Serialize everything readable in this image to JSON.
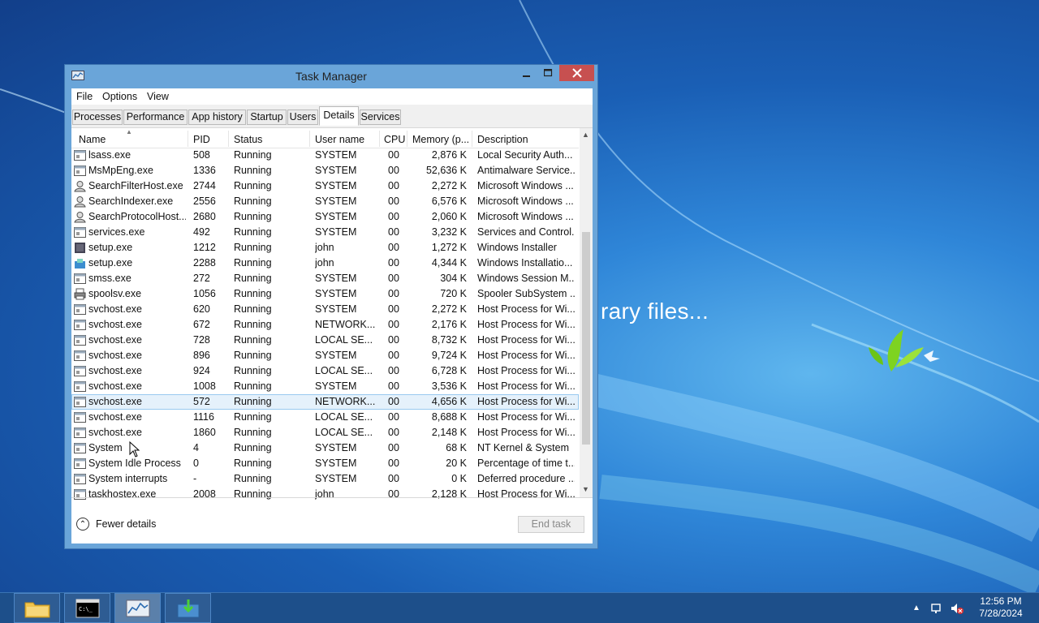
{
  "desktop": {
    "background_text": "rary files..."
  },
  "window": {
    "title": "Task Manager"
  },
  "menu": [
    "File",
    "Options",
    "View"
  ],
  "tabs": [
    {
      "label": "Processes"
    },
    {
      "label": "Performance"
    },
    {
      "label": "App history"
    },
    {
      "label": "Startup"
    },
    {
      "label": "Users"
    },
    {
      "label": "Details",
      "active": true
    },
    {
      "label": "Services"
    }
  ],
  "columns": {
    "name": "Name",
    "pid": "PID",
    "status": "Status",
    "user": "User name",
    "cpu": "CPU",
    "memory": "Memory (p...",
    "description": "Description"
  },
  "rows": [
    {
      "icon": "app",
      "name": "lsass.exe",
      "pid": "508",
      "status": "Running",
      "user": "SYSTEM",
      "cpu": "00",
      "memory": "2,876 K",
      "description": "Local Security Auth..."
    },
    {
      "icon": "app",
      "name": "MsMpEng.exe",
      "pid": "1336",
      "status": "Running",
      "user": "SYSTEM",
      "cpu": "00",
      "memory": "52,636 K",
      "description": "Antimalware Service..."
    },
    {
      "icon": "search",
      "name": "SearchFilterHost.exe",
      "pid": "2744",
      "status": "Running",
      "user": "SYSTEM",
      "cpu": "00",
      "memory": "2,272 K",
      "description": "Microsoft Windows ..."
    },
    {
      "icon": "search",
      "name": "SearchIndexer.exe",
      "pid": "2556",
      "status": "Running",
      "user": "SYSTEM",
      "cpu": "00",
      "memory": "6,576 K",
      "description": "Microsoft Windows ..."
    },
    {
      "icon": "search",
      "name": "SearchProtocolHost....",
      "pid": "2680",
      "status": "Running",
      "user": "SYSTEM",
      "cpu": "00",
      "memory": "2,060 K",
      "description": "Microsoft Windows ..."
    },
    {
      "icon": "app",
      "name": "services.exe",
      "pid": "492",
      "status": "Running",
      "user": "SYSTEM",
      "cpu": "00",
      "memory": "3,232 K",
      "description": "Services and Control..."
    },
    {
      "icon": "installer",
      "name": "setup.exe",
      "pid": "1212",
      "status": "Running",
      "user": "john",
      "cpu": "00",
      "memory": "1,272 K",
      "description": "Windows Installer"
    },
    {
      "icon": "setup",
      "name": "setup.exe",
      "pid": "2288",
      "status": "Running",
      "user": "john",
      "cpu": "00",
      "memory": "4,344 K",
      "description": "Windows Installatio..."
    },
    {
      "icon": "app",
      "name": "smss.exe",
      "pid": "272",
      "status": "Running",
      "user": "SYSTEM",
      "cpu": "00",
      "memory": "304 K",
      "description": "Windows Session M..."
    },
    {
      "icon": "printer",
      "name": "spoolsv.exe",
      "pid": "1056",
      "status": "Running",
      "user": "SYSTEM",
      "cpu": "00",
      "memory": "720 K",
      "description": "Spooler SubSystem ..."
    },
    {
      "icon": "app",
      "name": "svchost.exe",
      "pid": "620",
      "status": "Running",
      "user": "SYSTEM",
      "cpu": "00",
      "memory": "2,272 K",
      "description": "Host Process for Wi..."
    },
    {
      "icon": "app",
      "name": "svchost.exe",
      "pid": "672",
      "status": "Running",
      "user": "NETWORK...",
      "cpu": "00",
      "memory": "2,176 K",
      "description": "Host Process for Wi..."
    },
    {
      "icon": "app",
      "name": "svchost.exe",
      "pid": "728",
      "status": "Running",
      "user": "LOCAL SE...",
      "cpu": "00",
      "memory": "8,732 K",
      "description": "Host Process for Wi..."
    },
    {
      "icon": "app",
      "name": "svchost.exe",
      "pid": "896",
      "status": "Running",
      "user": "SYSTEM",
      "cpu": "00",
      "memory": "9,724 K",
      "description": "Host Process for Wi..."
    },
    {
      "icon": "app",
      "name": "svchost.exe",
      "pid": "924",
      "status": "Running",
      "user": "LOCAL SE...",
      "cpu": "00",
      "memory": "6,728 K",
      "description": "Host Process for Wi..."
    },
    {
      "icon": "app",
      "name": "svchost.exe",
      "pid": "1008",
      "status": "Running",
      "user": "SYSTEM",
      "cpu": "00",
      "memory": "3,536 K",
      "description": "Host Process for Wi..."
    },
    {
      "icon": "app",
      "name": "svchost.exe",
      "pid": "572",
      "status": "Running",
      "user": "NETWORK...",
      "cpu": "00",
      "memory": "4,656 K",
      "description": "Host Process for Wi...",
      "selected": true
    },
    {
      "icon": "app",
      "name": "svchost.exe",
      "pid": "1116",
      "status": "Running",
      "user": "LOCAL SE...",
      "cpu": "00",
      "memory": "8,688 K",
      "description": "Host Process for Wi..."
    },
    {
      "icon": "app",
      "name": "svchost.exe",
      "pid": "1860",
      "status": "Running",
      "user": "LOCAL SE...",
      "cpu": "00",
      "memory": "2,148 K",
      "description": "Host Process for Wi..."
    },
    {
      "icon": "app",
      "name": "System",
      "pid": "4",
      "status": "Running",
      "user": "SYSTEM",
      "cpu": "00",
      "memory": "68 K",
      "description": "NT Kernel & System"
    },
    {
      "icon": "app",
      "name": "System Idle Process",
      "pid": "0",
      "status": "Running",
      "user": "SYSTEM",
      "cpu": "00",
      "memory": "20 K",
      "description": "Percentage of time t..."
    },
    {
      "icon": "app",
      "name": "System interrupts",
      "pid": "-",
      "status": "Running",
      "user": "SYSTEM",
      "cpu": "00",
      "memory": "0 K",
      "description": "Deferred procedure ..."
    },
    {
      "icon": "app",
      "name": "taskhostex.exe",
      "pid": "2008",
      "status": "Running",
      "user": "john",
      "cpu": "00",
      "memory": "2,128 K",
      "description": "Host Process for Wi..."
    }
  ],
  "footer": {
    "fewer_details": "Fewer details",
    "end_task": "End task"
  },
  "taskbar": {
    "apps": [
      {
        "name": "file-explorer"
      },
      {
        "name": "command-prompt"
      },
      {
        "name": "task-manager",
        "active": true
      },
      {
        "name": "installer"
      }
    ],
    "clock": {
      "time": "12:56 PM",
      "date": "7/28/2024"
    }
  },
  "colors": {
    "accent": "#6aa5d9",
    "close": "#c75050",
    "selected_row": "#e5f1fb",
    "taskbar": "#1d4f8a"
  }
}
